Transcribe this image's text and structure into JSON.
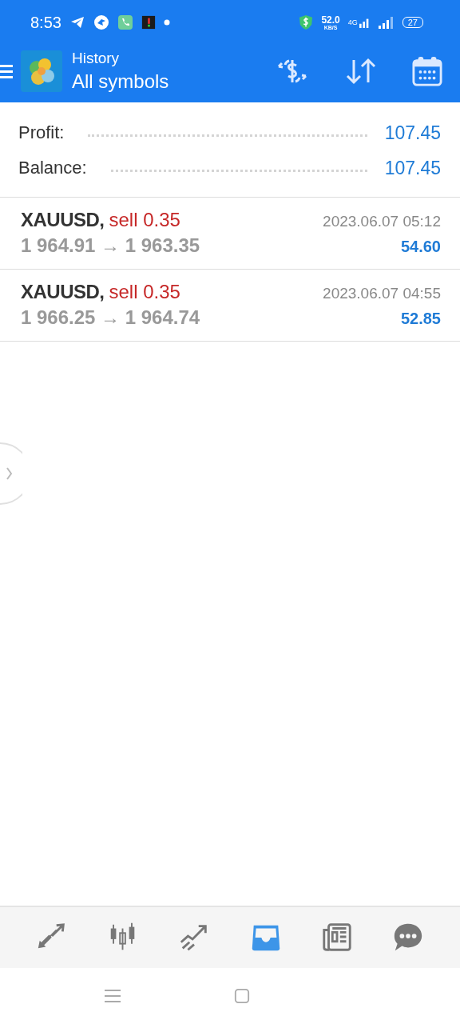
{
  "status_bar": {
    "time": "8:53",
    "speed": "52.0",
    "speed_unit": "KB/S",
    "network": "4G",
    "battery": "27"
  },
  "header": {
    "title": "History",
    "subtitle": "All symbols"
  },
  "summary": [
    {
      "label": "Profit:",
      "value": "107.45"
    },
    {
      "label": "Balance:",
      "value": "107.45"
    }
  ],
  "trades": [
    {
      "symbol": "XAUUSD,",
      "order": "sell 0.35",
      "time": "2023.06.07 05:12",
      "prices": "1 964.91 → 1 963.35",
      "profit": "54.60"
    },
    {
      "symbol": "XAUUSD,",
      "order": "sell 0.35",
      "time": "2023.06.07 04:55",
      "prices": "1 966.25 → 1 964.74",
      "profit": "52.85"
    }
  ],
  "bottom_nav": [
    {
      "kind": "quotes",
      "selected": false
    },
    {
      "kind": "chart",
      "selected": false
    },
    {
      "kind": "trade",
      "selected": false
    },
    {
      "kind": "history",
      "selected": true
    },
    {
      "kind": "news",
      "selected": false
    },
    {
      "kind": "messages",
      "selected": false
    }
  ]
}
